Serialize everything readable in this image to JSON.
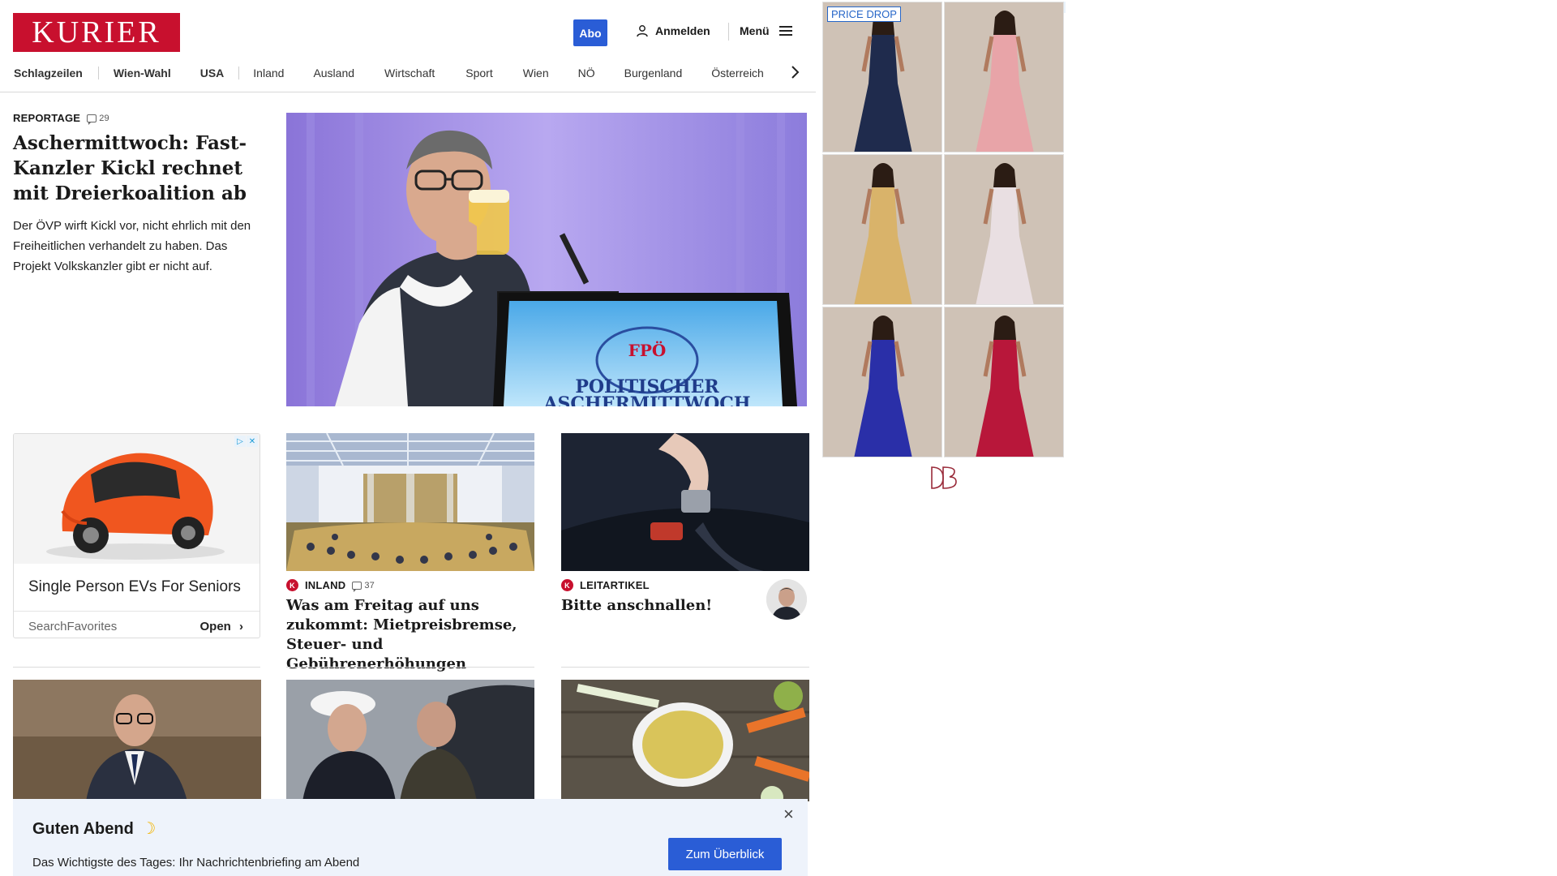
{
  "header": {
    "logo": "KURIER",
    "abo_label": "Abo",
    "login_label": "Anmelden",
    "menu_label": "Menü"
  },
  "nav": {
    "items": [
      "Schlagzeilen",
      "Wien-Wahl",
      "USA",
      "Inland",
      "Ausland",
      "Wirtschaft",
      "Sport",
      "Wien",
      "NÖ",
      "Burgenland",
      "Österreich"
    ]
  },
  "lead": {
    "kicker": "REPORTAGE",
    "comments": "29",
    "title": "Aschermittwoch: Fast-Kanzler Kickl rechnet mit Dreierkoalition ab",
    "teaser": "Der ÖVP wirft Kickl vor, nicht ehrlich mit den Freiheitlichen verhandelt zu haben. Das Projekt Volkskanzler gibt er nicht auf.",
    "image_sign_top": "FPÖ",
    "image_sign_bottom": "POLITISCHER",
    "image_sign_cut": "ASCHERMITTWOCH"
  },
  "ad_car": {
    "title": "Single Person EVs For Seniors",
    "source": "SearchFavorites",
    "cta": "Open"
  },
  "cards": [
    {
      "kicker": "INLAND",
      "comments": "37",
      "title": "Was am Freitag auf uns zukommt: Mietpreisbremse, Steuer- und Gebührenerhöhungen"
    },
    {
      "kicker": "LEITARTIKEL",
      "title": "Bitte anschnallen!"
    }
  ],
  "ad_dresses": {
    "badge": "PRICE DROP",
    "colors": [
      "#1f2b4d",
      "#e8a4a8",
      "#d9b36a",
      "#e9dfe2",
      "#2a2fa8",
      "#b8173a"
    ]
  },
  "briefing": {
    "title": "Guten Abend",
    "subtitle": "Das Wichtigste des Tages: Ihr Nachrichtenbriefing am Abend",
    "button": "Zum Überblick"
  }
}
